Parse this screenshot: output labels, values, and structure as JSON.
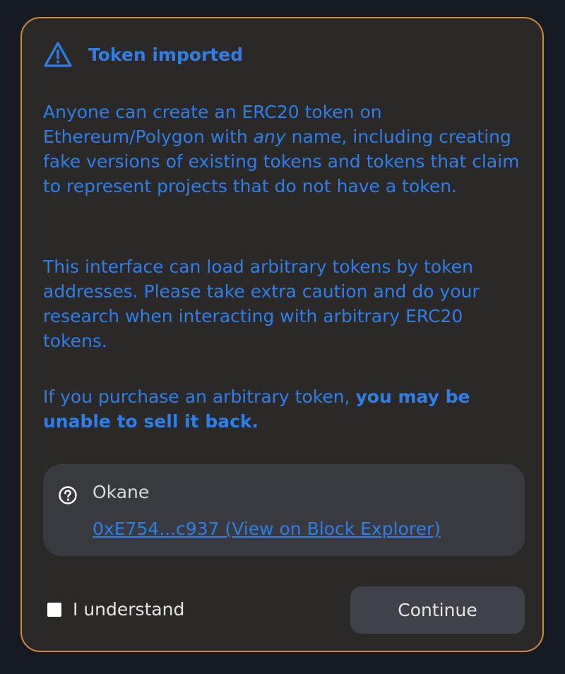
{
  "modal": {
    "title": "Token imported",
    "icon": "warning-triangle-icon",
    "accent_color": "#2f7fe8",
    "border_color": "#d18a35",
    "paragraph1": {
      "before": "Anyone can create an ERC20 token on Ethereum/Polygon with ",
      "emphasis": "any",
      "after": " name, including creating fake versions of existing tokens and tokens that claim to represent projects that do not have a token."
    },
    "paragraph2": "This interface can load arbitrary tokens by token addresses. Please take extra caution and do your research when interacting with arbitrary ERC20 tokens.",
    "paragraph3": {
      "before": "If you purchase an arbitrary token, ",
      "strong": "you may be unable to sell it back."
    },
    "token": {
      "icon": "question-circle-icon",
      "name": "Okane",
      "link_text": "0xE754...c937 (View on Block Explorer)"
    },
    "understand": {
      "label": "I understand",
      "checked": false
    },
    "continue_label": "Continue"
  }
}
